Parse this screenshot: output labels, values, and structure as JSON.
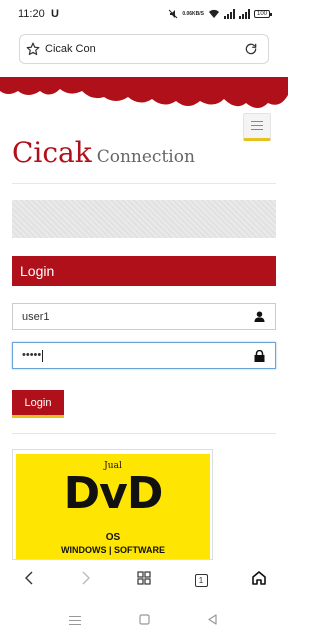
{
  "status_bar": {
    "time": "11:20",
    "carrier_icon": "U",
    "speed_value": "0.06",
    "speed_unit": "KB/S",
    "battery": "100"
  },
  "browser": {
    "url_text": "Cicak Con",
    "tab_count": "1"
  },
  "site": {
    "logo_main": "Cicak",
    "logo_sub": "Connection"
  },
  "login": {
    "heading": "Login",
    "username_value": "user1",
    "password_value": "•••••",
    "button_label": "Login"
  },
  "banner": {
    "small_text": "Jual",
    "title": "DvD",
    "os_text": "OS",
    "subtitle": "WINDOWS | SOFTWARE"
  },
  "colors": {
    "brand_red": "#b01019",
    "accent_yellow": "#e5c21d",
    "banner_yellow": "#ffe602"
  }
}
